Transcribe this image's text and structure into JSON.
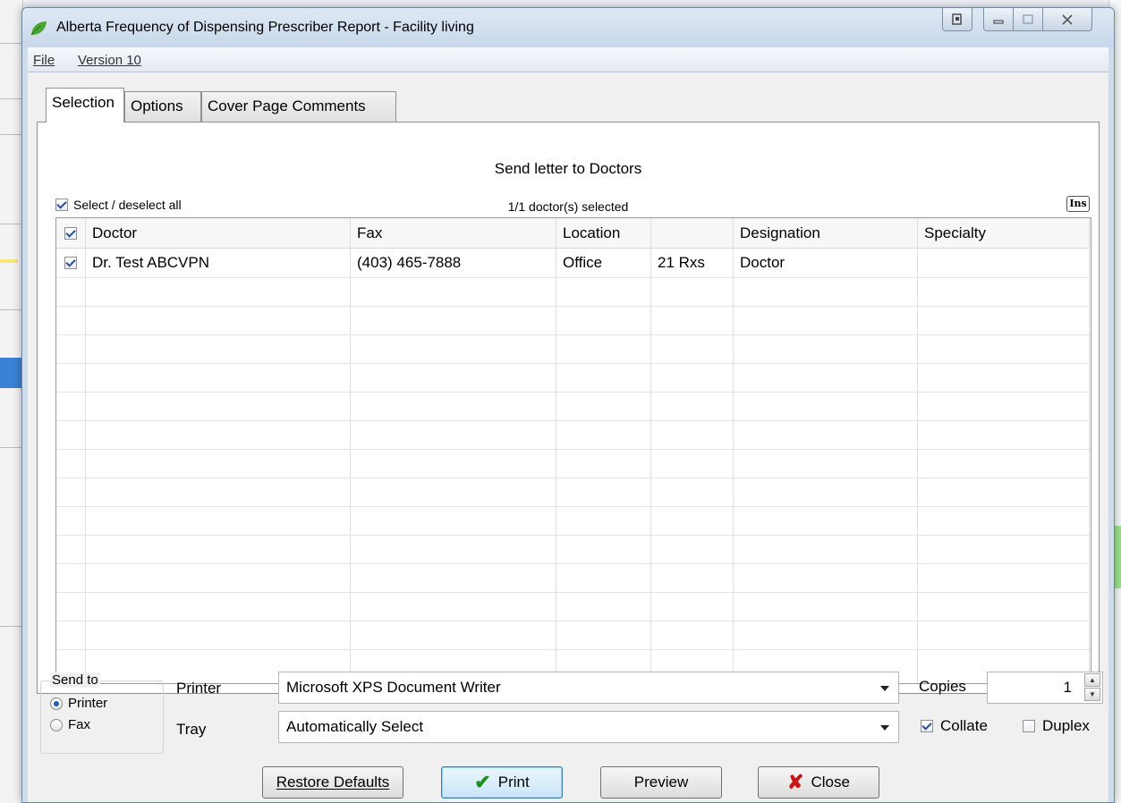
{
  "window": {
    "title": "Alberta Frequency of Dispensing Prescriber Report - Facility living"
  },
  "menu": {
    "file": "File",
    "version": "Version 10"
  },
  "tabs": [
    {
      "label": "Selection",
      "active": true
    },
    {
      "label": "Options",
      "active": false
    },
    {
      "label": "Cover Page Comments",
      "active": false
    }
  ],
  "selection": {
    "heading": "Send letter to Doctors",
    "select_all_label": "Select / deselect all",
    "select_all_checked": true,
    "selected_count": "1/1 doctor(s) selected",
    "ins_key": "Ins",
    "columns": [
      "Doctor",
      "Fax",
      "Location",
      "",
      "Designation",
      "Specialty"
    ],
    "rows": [
      {
        "checked": true,
        "doctor": "Dr. Test ABCVPN",
        "fax": "(403) 465-7888",
        "location": "Office",
        "rxs": "21 Rxs",
        "designation": "Doctor",
        "specialty": ""
      }
    ]
  },
  "output": {
    "send_to_label": "Send to",
    "send_to_options": [
      {
        "label": "Printer",
        "selected": true
      },
      {
        "label": "Fax",
        "selected": false
      }
    ],
    "printer_label": "Printer",
    "printer_value": "Microsoft XPS Document Writer",
    "tray_label": "Tray",
    "tray_value": "Automatically Select",
    "copies_label": "Copies",
    "copies_value": "1",
    "collate_label": "Collate",
    "collate_checked": true,
    "duplex_label": "Duplex",
    "duplex_checked": false
  },
  "buttons": {
    "restore_defaults": "Restore Defaults",
    "print": "Print",
    "preview": "Preview",
    "close": "Close"
  },
  "colors": {
    "title_bar": "#cfdceb",
    "default_button": "#c9e5f7",
    "print_check": "#1b8f1b",
    "close_x": "#c81414"
  }
}
